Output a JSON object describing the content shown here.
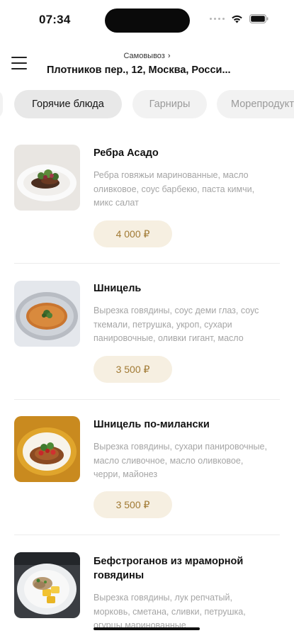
{
  "status_bar": {
    "time": "07:34"
  },
  "header": {
    "delivery_mode": "Самовывоз",
    "delivery_mode_chevron": "›",
    "address": "Плотников пер., 12, Москва, Росси..."
  },
  "categories": [
    {
      "label": "",
      "active": false
    },
    {
      "label": "Горячие блюда",
      "active": true
    },
    {
      "label": "Гарниры",
      "active": false
    },
    {
      "label": "Морепродукты",
      "active": false
    }
  ],
  "products": [
    {
      "name": "Ребра Асадо",
      "description": "Ребра говяжьи маринованные, масло оливковое, соус барбекю, паста кимчи, микс салат",
      "price": "4 000 ₽",
      "image_icon": "plated-ribs-image"
    },
    {
      "name": "Шницель",
      "description": "Вырезка говядины, соус деми глаз, соус ткемали, петрушка, укроп, сухари панировочные, оливки гигант, масло",
      "price": "3 500 ₽",
      "image_icon": "schnitzel-plate-image"
    },
    {
      "name": "Шницель по-милански",
      "description": "Вырезка говядины, сухари панировочные, масло сливочное, масло оливковое, черри, майонез",
      "price": "3 500 ₽",
      "image_icon": "milanese-schnitzel-image"
    },
    {
      "name": "Бефстроганов из мраморной говядины",
      "description": "Вырезка говядины, лук репчатый, морковь, сметана, сливки, петрушка, огурцы маринованные",
      "price": "",
      "image_icon": "stroganoff-plate-image"
    }
  ],
  "colors": {
    "price_bg": "#f6efe1",
    "price_text": "#a17a34",
    "active_tab_bg": "#e8e8e8",
    "muted_text": "#a5a5a5"
  }
}
